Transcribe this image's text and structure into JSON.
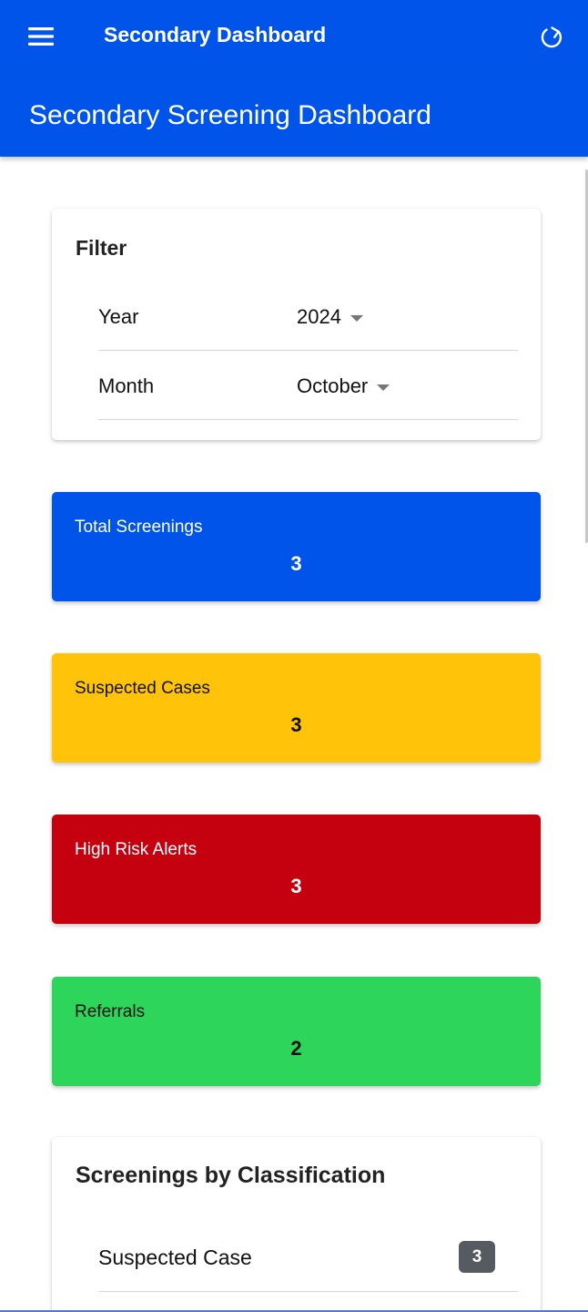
{
  "toolbar": {
    "title": "Secondary Dashboard",
    "menu_icon": "menu-icon",
    "refresh_icon": "refresh-icon"
  },
  "header": {
    "title": "Secondary Screening Dashboard"
  },
  "filter": {
    "title": "Filter",
    "year_label": "Year",
    "year_value": "2024",
    "month_label": "Month",
    "month_value": "October"
  },
  "stats": [
    {
      "label": "Total Screenings",
      "value": "3",
      "color": "#0054e9"
    },
    {
      "label": "Suspected Cases",
      "value": "3",
      "color": "#ffc409"
    },
    {
      "label": "High Risk Alerts",
      "value": "3",
      "color": "#c5000f"
    },
    {
      "label": "Referrals",
      "value": "2",
      "color": "#2dd55b"
    }
  ],
  "classification": {
    "title": "Screenings by Classification",
    "rows": [
      {
        "label": "Suspected Case",
        "count": "3"
      }
    ]
  }
}
